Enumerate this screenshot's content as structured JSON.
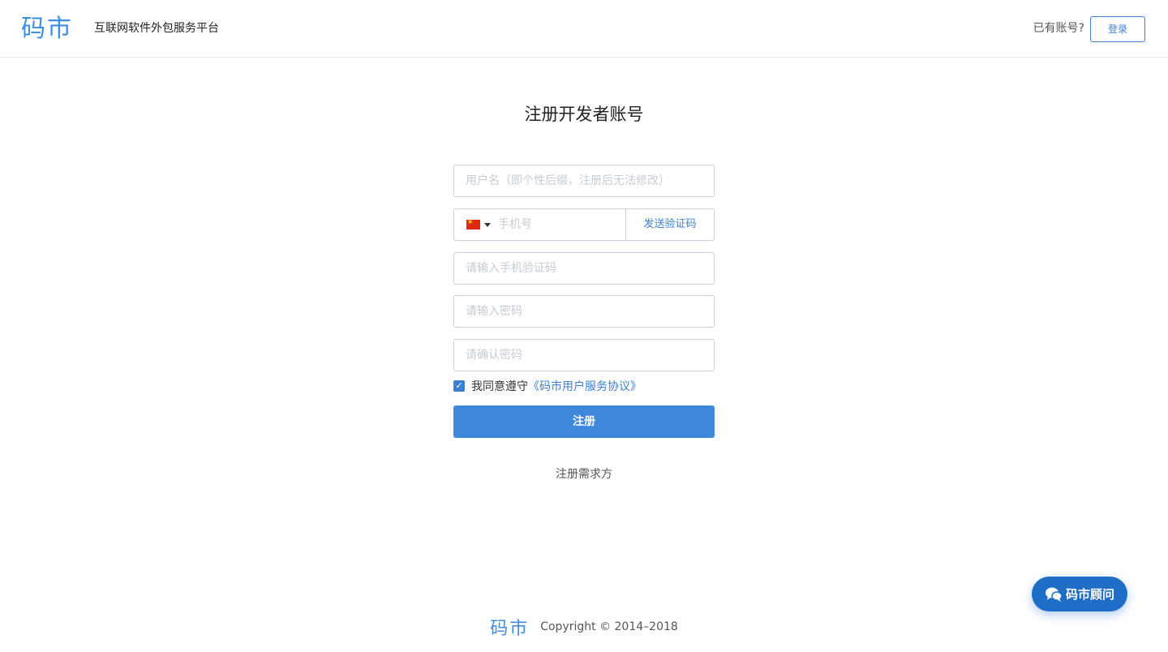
{
  "header": {
    "logo": "码市",
    "tagline": "互联网软件外包服务平台",
    "has_account": "已有账号?",
    "login_label": "登录"
  },
  "form": {
    "title": "注册开发者账号",
    "username_placeholder": "用户名（即个性后缀，注册后无法修改）",
    "phone_placeholder": "手机号",
    "country_flag_icon": "china-flag-icon",
    "send_code_label": "发送验证码",
    "sms_code_placeholder": "请输入手机验证码",
    "password_placeholder": "请输入密码",
    "confirm_password_placeholder": "请确认密码",
    "agree_checked": true,
    "agree_prefix": "我同意遵守",
    "agree_link": "《码市用户服务协议》",
    "register_label": "注册"
  },
  "alt_register": "注册需求方",
  "footer": {
    "logo": "码市",
    "copyright": "Copyright © 2014–2018"
  },
  "advisor": {
    "icon": "chat-bubbles-icon",
    "label": "码市顾问"
  },
  "colors": {
    "brand": "#3d8ee0",
    "primary_button": "#3f87db",
    "link": "#3d7fd1",
    "advisor_button": "#1e6ec8"
  }
}
